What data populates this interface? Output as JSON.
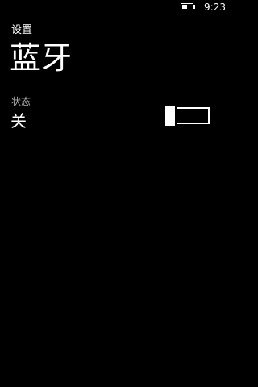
{
  "status_bar": {
    "time": "9:23",
    "battery_icon": "battery-icon",
    "battery_level": 0.5
  },
  "header": {
    "app_title": "设置",
    "page_title": "蓝牙"
  },
  "setting": {
    "label": "状态",
    "value": "关",
    "toggle_on": false
  },
  "colors": {
    "background": "#000000",
    "foreground": "#ffffff",
    "secondary_text": "#a6a6a6"
  }
}
